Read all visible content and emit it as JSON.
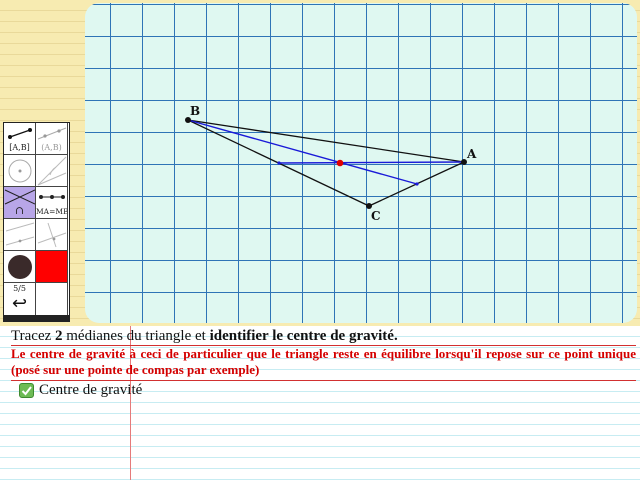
{
  "figure": {
    "points": [
      {
        "id": "A",
        "label": "A"
      },
      {
        "id": "B",
        "label": "B"
      },
      {
        "id": "C",
        "label": "C"
      }
    ]
  },
  "toolbar": {
    "segment_label": "[A,B]",
    "segment_faded_label": "(A,B)",
    "equal_length_label": "MA=MB",
    "intersection_symbol": "∩",
    "page_indicator": "5/5",
    "undo_symbol": "↩",
    "colors": {
      "active": "#b8a6e8",
      "point_dark": "#3a2a2a",
      "red": "#ff0000"
    }
  },
  "instruction": {
    "part1": "Tracez ",
    "count": "2",
    "part2": " médianes du triangle et ",
    "bold_part": "identifier le centre de gravité."
  },
  "info_text": "Le centre de gravité à ceci de particulier que le triangle reste en équilibre lorsqu'il repose sur ce point unique (posé sur une pointe de compas par exemple)",
  "checkbox": {
    "label": "Centre de gravité",
    "checked": true
  }
}
